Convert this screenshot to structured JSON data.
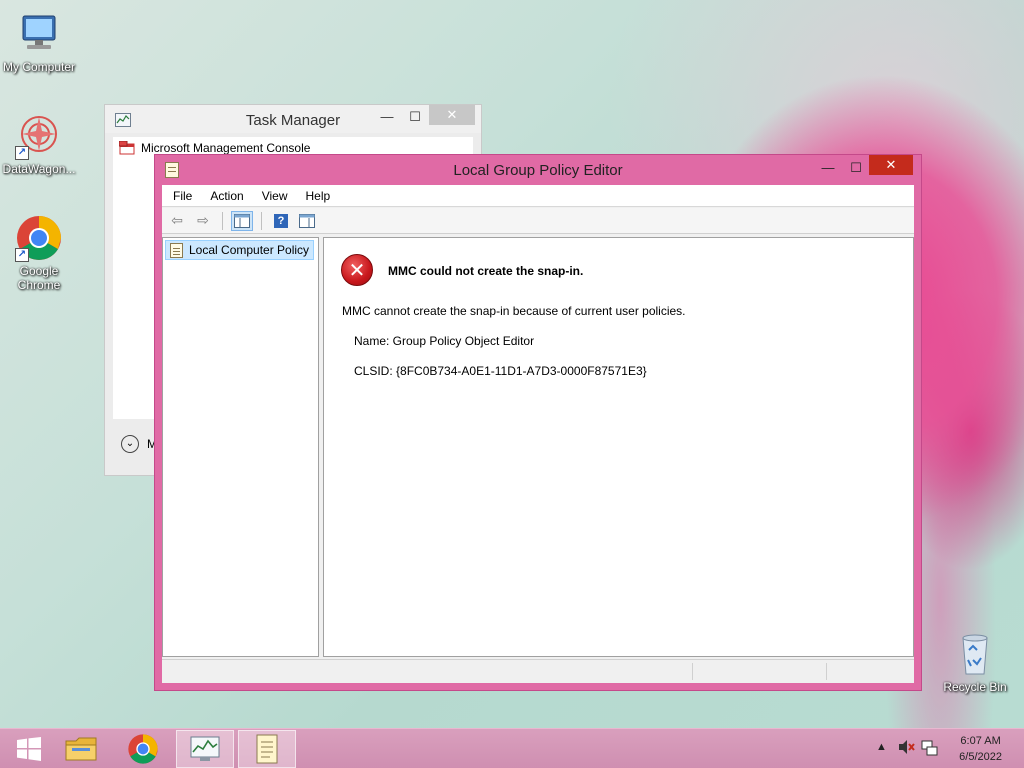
{
  "desktop": {
    "icons": [
      {
        "label": "My Computer"
      },
      {
        "label": "DataWagon..."
      },
      {
        "label": "Google Chrome"
      },
      {
        "label": "Recycle Bin"
      }
    ]
  },
  "task_manager": {
    "title": "Task Manager",
    "process_name": "Microsoft Management Console",
    "more_label": "M",
    "min_glyph": "—",
    "max_glyph": "☐",
    "close_glyph": "✕",
    "chevron_glyph": "⌄"
  },
  "gpe": {
    "title": "Local Group Policy Editor",
    "min_glyph": "—",
    "max_glyph": "☐",
    "close_glyph": "✕",
    "menu": [
      "File",
      "Action",
      "View",
      "Help"
    ],
    "tree_root": "Local Computer Policy",
    "error": {
      "glyph": "✕",
      "title": "MMC could not create the snap-in.",
      "message": "MMC cannot create the snap-in because of current user policies.",
      "name_line": "Name: Group Policy Object Editor",
      "clsid_line": "CLSID: {8FC0B734-A0E1-11D1-A7D3-0000F87571E3}"
    },
    "toolbar": {
      "back_glyph": "⇦",
      "forward_glyph": "⇨",
      "help_glyph": "?"
    }
  },
  "taskbar": {
    "time": "6:07 AM",
    "date": "6/5/2022",
    "tray_chevron": "▲"
  },
  "colors": {
    "window_border_accent": "#e06aa5",
    "close_button": "#c42b1c",
    "error_red": "#c8171c",
    "selection": "#cce8ff"
  }
}
